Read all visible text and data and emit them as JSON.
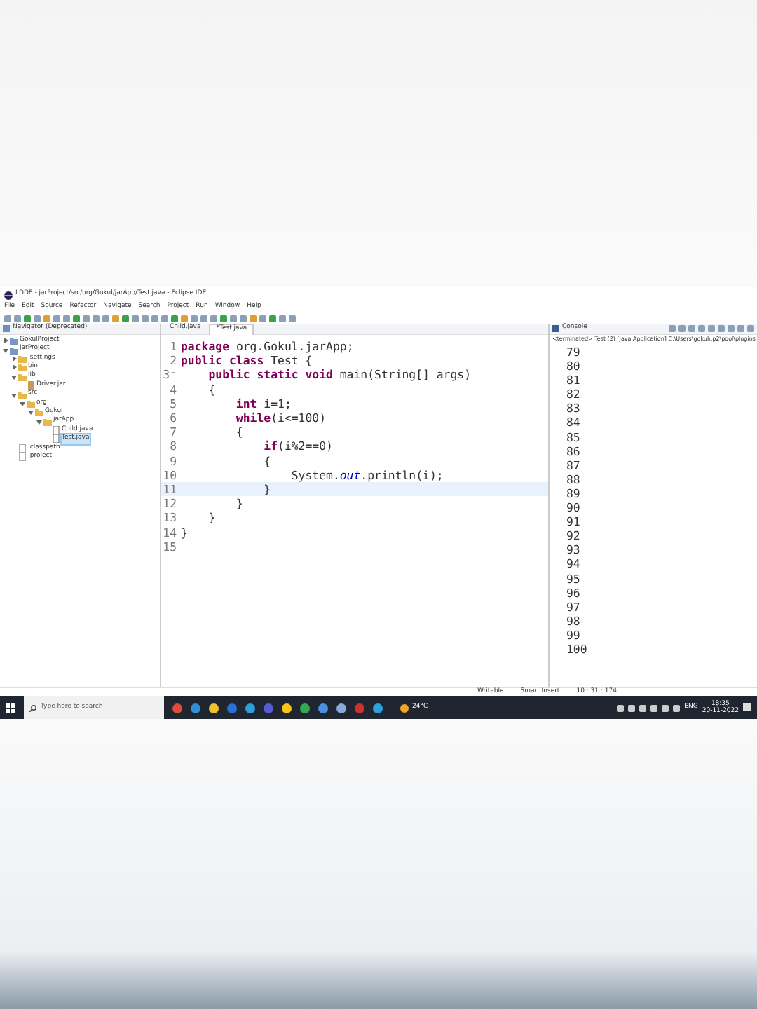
{
  "window": {
    "title": "LDDE - jarProject/src/org/Gokul/jarApp/Test.java - Eclipse IDE"
  },
  "menu": [
    "File",
    "Edit",
    "Source",
    "Refactor",
    "Navigate",
    "Search",
    "Project",
    "Run",
    "Window",
    "Help"
  ],
  "navigator": {
    "title": "Navigator (Deprecated)",
    "items": [
      {
        "label": "GokulProject",
        "kind": "project",
        "expanded": false,
        "selected": false
      },
      {
        "label": "jarProject",
        "kind": "project",
        "expanded": true,
        "selected": false,
        "children": [
          {
            "label": ".settings",
            "kind": "folder",
            "expanded": false,
            "selected": false
          },
          {
            "label": "bin",
            "kind": "folder",
            "expanded": false,
            "selected": false
          },
          {
            "label": "lib",
            "kind": "folder",
            "expanded": true,
            "selected": false,
            "children": [
              {
                "label": "Driver.jar",
                "kind": "jar",
                "selected": false
              }
            ]
          },
          {
            "label": "src",
            "kind": "folder",
            "expanded": true,
            "selected": false,
            "children": [
              {
                "label": "org",
                "kind": "folder",
                "expanded": true,
                "selected": false,
                "children": [
                  {
                    "label": "Gokul",
                    "kind": "folder",
                    "expanded": true,
                    "selected": false,
                    "children": [
                      {
                        "label": "jarApp",
                        "kind": "folder",
                        "expanded": true,
                        "selected": false,
                        "children": [
                          {
                            "label": "Child.java",
                            "kind": "file",
                            "selected": false
                          },
                          {
                            "label": "Test.java",
                            "kind": "file",
                            "selected": true
                          }
                        ]
                      }
                    ]
                  }
                ]
              }
            ]
          },
          {
            "label": ".classpath",
            "kind": "file",
            "selected": false
          },
          {
            "label": ".project",
            "kind": "file",
            "selected": false
          }
        ]
      }
    ]
  },
  "editor": {
    "tabs": [
      {
        "label": "Child.java",
        "selected": false
      },
      {
        "label": "*Test.java",
        "selected": true
      }
    ],
    "lines": [
      {
        "number": "1",
        "tokens": [
          {
            "text": "package",
            "kind": "keyword"
          },
          {
            "text": " org.Gokul.jarApp;",
            "kind": "plain"
          }
        ]
      },
      {
        "number": "2",
        "tokens": [
          {
            "text": "public class",
            "kind": "keyword"
          },
          {
            "text": " Test {",
            "kind": "plain"
          }
        ]
      },
      {
        "number": "3⁻",
        "tokens": [
          {
            "text": "    public static void",
            "kind": "keyword"
          },
          {
            "text": " main(String[] args)",
            "kind": "plain"
          }
        ]
      },
      {
        "number": "4",
        "tokens": [
          {
            "text": "    {",
            "kind": "plain"
          }
        ]
      },
      {
        "number": "5",
        "tokens": [
          {
            "text": "        int",
            "kind": "keyword"
          },
          {
            "text": " i=1;",
            "kind": "plain"
          }
        ]
      },
      {
        "number": "6",
        "tokens": [
          {
            "text": "        while",
            "kind": "keyword"
          },
          {
            "text": "(i<=100)",
            "kind": "plain"
          }
        ]
      },
      {
        "number": "7",
        "tokens": [
          {
            "text": "        {",
            "kind": "plain"
          }
        ]
      },
      {
        "number": "8",
        "tokens": [
          {
            "text": "            if",
            "kind": "keyword"
          },
          {
            "text": "(i%2==0)",
            "kind": "plain"
          }
        ]
      },
      {
        "number": "9",
        "tokens": [
          {
            "text": "            {",
            "kind": "plain"
          }
        ]
      },
      {
        "number": "10",
        "tokens": [
          {
            "text": "                System.",
            "kind": "plain"
          },
          {
            "text": "out",
            "kind": "field"
          },
          {
            "text": ".println(i);",
            "kind": "plain"
          }
        ]
      },
      {
        "number": "11",
        "current": true,
        "tokens": [
          {
            "text": "            }",
            "kind": "plain"
          }
        ]
      },
      {
        "number": "12",
        "tokens": [
          {
            "text": "        }",
            "kind": "plain"
          }
        ]
      },
      {
        "number": "13",
        "tokens": [
          {
            "text": "    }",
            "kind": "plain"
          }
        ]
      },
      {
        "number": "14",
        "tokens": [
          {
            "text": "}",
            "kind": "plain"
          }
        ]
      },
      {
        "number": "15"
      }
    ]
  },
  "console": {
    "title": "Console",
    "subtitle": "<terminated> Test (2) [Java Application] C:\\Users\\gokul\\.p2\\pool\\plugins",
    "output": [
      "79",
      "80",
      "81",
      "82",
      "83",
      "84",
      "85",
      "86",
      "87",
      "88",
      "89",
      "90",
      "91",
      "92",
      "93",
      "94",
      "95",
      "96",
      "97",
      "98",
      "99",
      "100"
    ]
  },
  "status_bar": [
    "Writable",
    "Smart Insert",
    "10 : 31 : 174"
  ],
  "taskbar": {
    "search_placeholder": "Type here to search",
    "weather": "24°C",
    "language": "ENG",
    "time": "18:35",
    "date": "20-11-2022"
  }
}
